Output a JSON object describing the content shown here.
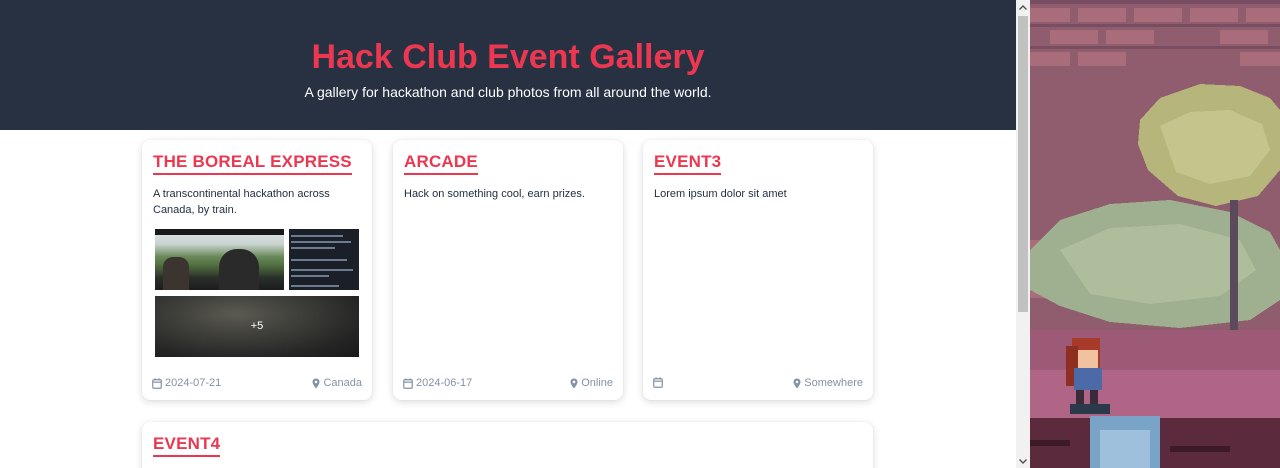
{
  "header": {
    "title": "Hack Club Event Gallery",
    "subtitle": "A gallery for hackathon and club photos from all around the world."
  },
  "events": [
    {
      "title": "THE BOREAL EXPRESS",
      "description": "A transcontinental hackathon across Canada, by train.",
      "date": "2024-07-21",
      "location": "Canada",
      "more_photos": "+5"
    },
    {
      "title": "ARCADE",
      "description": "Hack on something cool, earn prizes.",
      "date": "2024-06-17",
      "location": "Online"
    },
    {
      "title": "EVENT3",
      "description": "Lorem ipsum dolor sit amet",
      "date": "",
      "location": "Somewhere"
    },
    {
      "title": "EVENT4"
    }
  ],
  "icons": {
    "date": "calendar-icon",
    "location": "map-pin-icon",
    "scroll_up": "scroll-up-arrow-icon",
    "scroll_down": "scroll-down-arrow-icon"
  },
  "colors": {
    "accent": "#ec3750",
    "header_bg": "#273142",
    "meta_text": "#8492a6"
  }
}
